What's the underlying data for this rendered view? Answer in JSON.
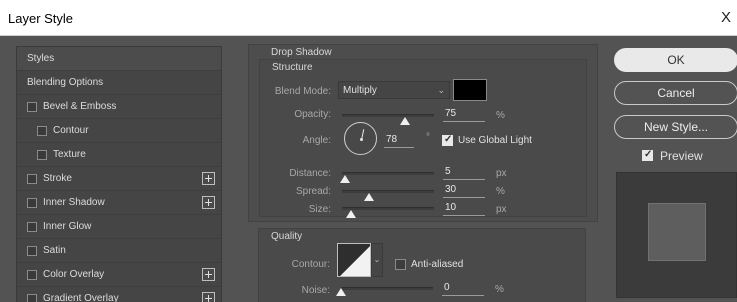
{
  "window": {
    "title": "Layer Style",
    "close": "X"
  },
  "styles_list": {
    "header": "Styles",
    "items": [
      {
        "label": "Blending Options",
        "has_checkbox": false,
        "has_plus": false
      },
      {
        "label": "Bevel & Emboss",
        "has_checkbox": true,
        "has_plus": false
      },
      {
        "label": "Contour",
        "has_checkbox": true,
        "has_plus": false
      },
      {
        "label": "Texture",
        "has_checkbox": true,
        "has_plus": false
      },
      {
        "label": "Stroke",
        "has_checkbox": true,
        "has_plus": true
      },
      {
        "label": "Inner Shadow",
        "has_checkbox": true,
        "has_plus": true
      },
      {
        "label": "Inner Glow",
        "has_checkbox": true,
        "has_plus": false
      },
      {
        "label": "Satin",
        "has_checkbox": true,
        "has_plus": false
      },
      {
        "label": "Color Overlay",
        "has_checkbox": true,
        "has_plus": true
      },
      {
        "label": "Gradient Overlay",
        "has_checkbox": true,
        "has_plus": true
      }
    ]
  },
  "drop_shadow": {
    "section_title": "Drop Shadow",
    "structure_title": "Structure",
    "blend_mode_label": "Blend Mode:",
    "blend_mode_value": "Multiply",
    "shadow_color": "#000000",
    "opacity_label": "Opacity:",
    "opacity_value": "75",
    "opacity_unit": "%",
    "opacity_fraction": 0.75,
    "angle_label": "Angle:",
    "angle_value": "78",
    "angle_unit": "°",
    "use_global_light_label": "Use Global Light",
    "use_global_light_checked": true,
    "distance_label": "Distance:",
    "distance_value": "5",
    "distance_unit": "px",
    "spread_label": "Spread:",
    "spread_value": "30",
    "spread_unit": "%",
    "size_label": "Size:",
    "size_value": "10",
    "size_unit": "px",
    "quality_title": "Quality",
    "contour_label": "Contour:",
    "anti_aliased_label": "Anti-aliased",
    "anti_aliased_checked": false,
    "noise_label": "Noise:",
    "noise_value": "0",
    "noise_unit": "%"
  },
  "buttons": {
    "ok": "OK",
    "cancel": "Cancel",
    "new_style": "New Style...",
    "preview_label": "Preview",
    "preview_checked": true
  }
}
